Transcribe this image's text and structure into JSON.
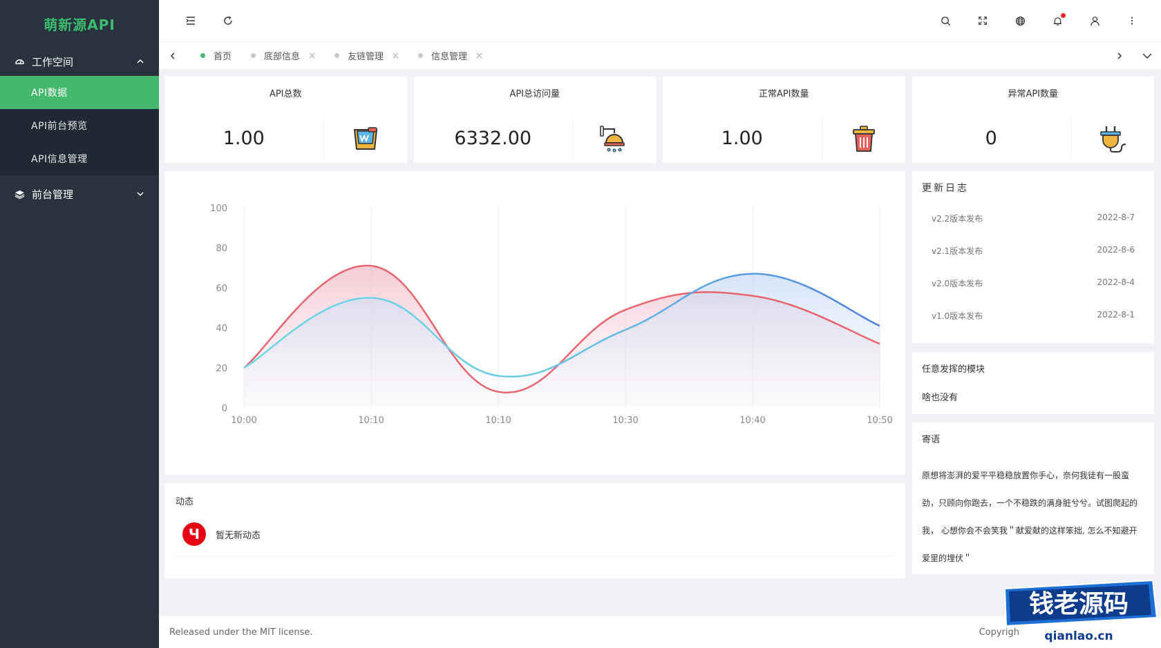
{
  "app": {
    "title": "萌新源API"
  },
  "sidebar": {
    "groups": [
      {
        "label": "工作空间",
        "icon": "dashboard-icon",
        "expanded": true,
        "items": [
          {
            "label": "API数据",
            "active": true
          },
          {
            "label": "API前台预览",
            "active": false
          },
          {
            "label": "API信息管理",
            "active": false
          }
        ]
      },
      {
        "label": "前台管理",
        "icon": "layers-icon",
        "expanded": false,
        "items": []
      }
    ]
  },
  "header": {
    "left_icons": [
      "menu-fold-icon",
      "refresh-icon"
    ],
    "right_icons": [
      "search-icon",
      "fullscreen-icon",
      "globe-icon",
      "bell-icon",
      "user-icon",
      "more-icon"
    ]
  },
  "tabs": [
    {
      "label": "首页",
      "active": true,
      "closable": false
    },
    {
      "label": "底部信息",
      "active": false,
      "closable": true
    },
    {
      "label": "友链管理",
      "active": false,
      "closable": true
    },
    {
      "label": "信息管理",
      "active": false,
      "closable": true
    }
  ],
  "stats": [
    {
      "title": "API总数",
      "value": "1.00",
      "icon": "paint-bucket-icon"
    },
    {
      "title": "API总访问量",
      "value": "6332.00",
      "icon": "shower-icon"
    },
    {
      "title": "正常API数量",
      "value": "1.00",
      "icon": "trash-can-icon"
    },
    {
      "title": "异常API数量",
      "value": "0",
      "icon": "plug-icon"
    }
  ],
  "chart_data": {
    "type": "area",
    "categories": [
      "10:00",
      "10:10",
      "10:10",
      "10:30",
      "10:40",
      "10:50"
    ],
    "ylim": [
      0,
      100
    ],
    "yticks": [
      0,
      20,
      40,
      60,
      80,
      100
    ],
    "series": [
      {
        "values": [
          20,
          71,
          8,
          49,
          56,
          32
        ],
        "color": "#e8656f",
        "fill": "#f6d3dc"
      },
      {
        "values": [
          20,
          55,
          16,
          39,
          67,
          41
        ],
        "color": "#4e86e4",
        "fill": "#dce8fa",
        "color_start": "#6ed8e6"
      }
    ]
  },
  "dynamics": {
    "title": "动态",
    "items": [
      {
        "avatar_char": "Ч",
        "text": "暂无新动态"
      }
    ]
  },
  "changelog": {
    "title": "更新日志",
    "rows": [
      {
        "version": "v2.2版本发布",
        "date": "2022-8-7"
      },
      {
        "version": "v2.1版本发布",
        "date": "2022-8-6"
      },
      {
        "version": "v2.0版本发布",
        "date": "2022-8-4"
      },
      {
        "version": "v1.0版本发布",
        "date": "2022-8-1"
      }
    ]
  },
  "module": {
    "title": "任意发挥的模块",
    "text": "啥也没有"
  },
  "message": {
    "title": "寄语",
    "text": "原想将澎湃的爱平平稳稳放置你手心，奈何我徒有一股蛮劲，只顾向你跑去，一个不稳跌的满身脏兮兮。试图爬起的我， 心想你会不会笑我＂献爱献的这样笨拙, 怎么不知避开爱里的埋伏＂"
  },
  "footer": {
    "left": "Released under the MIT license.",
    "right": "Copyrigh"
  },
  "watermark": {
    "title": "钱老源码",
    "url": "qianlao.cn"
  }
}
